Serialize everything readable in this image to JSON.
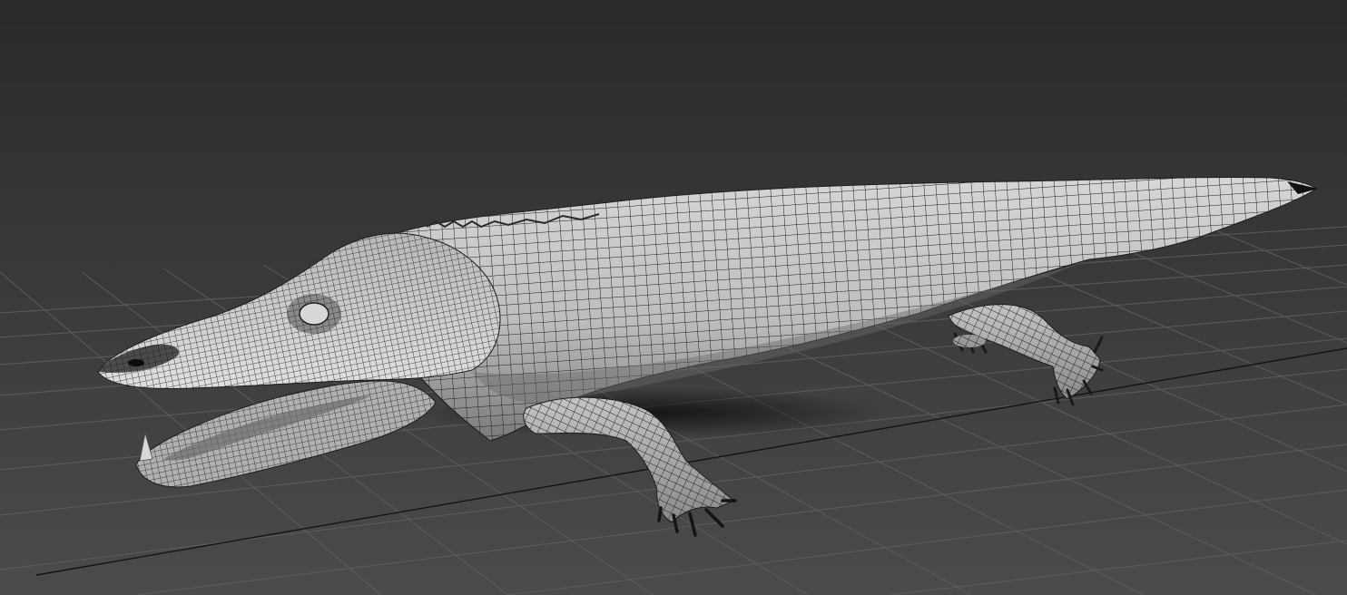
{
  "viewport": {
    "scene_object": "crocodile-wireframe-mesh",
    "shading_mode": "edged-faces",
    "colors": {
      "background_top": "#2a2a2a",
      "background_bottom": "#4a4a4a",
      "grid_line": "#5a5a5a",
      "grid_axis": "#141414",
      "mesh_fill_light": "#d2d2d2",
      "mesh_fill_dark": "#8c8c8c",
      "wire": "#1e1e1e"
    }
  }
}
